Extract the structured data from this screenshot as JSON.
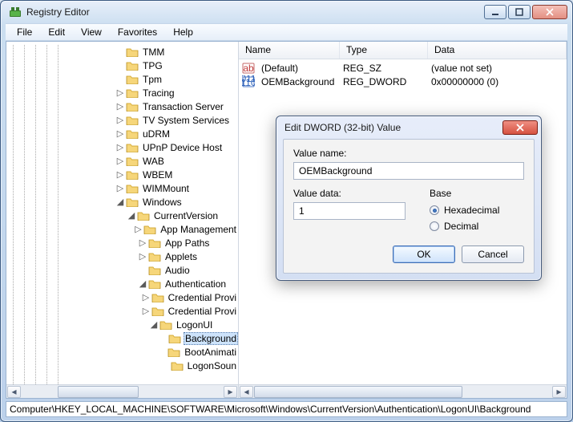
{
  "window": {
    "title": "Registry Editor"
  },
  "menubar": [
    "File",
    "Edit",
    "View",
    "Favorites",
    "Help"
  ],
  "tree": [
    {
      "depth": 5,
      "twisty": "",
      "label": "TMM"
    },
    {
      "depth": 5,
      "twisty": "",
      "label": "TPG"
    },
    {
      "depth": 5,
      "twisty": "",
      "label": "Tpm"
    },
    {
      "depth": 5,
      "twisty": "right",
      "label": "Tracing"
    },
    {
      "depth": 5,
      "twisty": "right",
      "label": "Transaction Server"
    },
    {
      "depth": 5,
      "twisty": "right",
      "label": "TV System Services"
    },
    {
      "depth": 5,
      "twisty": "right",
      "label": "uDRM"
    },
    {
      "depth": 5,
      "twisty": "right",
      "label": "UPnP Device Host"
    },
    {
      "depth": 5,
      "twisty": "right",
      "label": "WAB"
    },
    {
      "depth": 5,
      "twisty": "right",
      "label": "WBEM"
    },
    {
      "depth": 5,
      "twisty": "right",
      "label": "WIMMount"
    },
    {
      "depth": 5,
      "twisty": "down",
      "label": "Windows"
    },
    {
      "depth": 6,
      "twisty": "down",
      "label": "CurrentVersion"
    },
    {
      "depth": 7,
      "twisty": "right",
      "label": "App Management"
    },
    {
      "depth": 7,
      "twisty": "right",
      "label": "App Paths"
    },
    {
      "depth": 7,
      "twisty": "right",
      "label": "Applets"
    },
    {
      "depth": 7,
      "twisty": "",
      "label": "Audio"
    },
    {
      "depth": 7,
      "twisty": "down",
      "label": "Authentication"
    },
    {
      "depth": 8,
      "twisty": "right",
      "label": "Credential Provi"
    },
    {
      "depth": 8,
      "twisty": "right",
      "label": "Credential Provi"
    },
    {
      "depth": 8,
      "twisty": "down",
      "label": "LogonUI"
    },
    {
      "depth": 9,
      "twisty": "",
      "label": "Background",
      "selected": true
    },
    {
      "depth": 9,
      "twisty": "",
      "label": "BootAnimati"
    },
    {
      "depth": 9,
      "twisty": "",
      "label": "LogonSoun"
    }
  ],
  "list": {
    "headers": {
      "name": "Name",
      "type": "Type",
      "data": "Data"
    },
    "rows": [
      {
        "icon": "sz",
        "name": "(Default)",
        "type": "REG_SZ",
        "data": "(value not set)"
      },
      {
        "icon": "dw",
        "name": "OEMBackground",
        "type": "REG_DWORD",
        "data": "0x00000000 (0)"
      }
    ]
  },
  "dialog": {
    "title": "Edit DWORD (32-bit) Value",
    "value_name_label": "Value name:",
    "value_name": "OEMBackground",
    "value_data_label": "Value data:",
    "value_data": "1",
    "base_label": "Base",
    "hex_label": "Hexadecimal",
    "dec_label": "Decimal",
    "base_selected": "hex",
    "ok": "OK",
    "cancel": "Cancel"
  },
  "statusbar": "Computer\\HKEY_LOCAL_MACHINE\\SOFTWARE\\Microsoft\\Windows\\CurrentVersion\\Authentication\\LogonUI\\Background"
}
